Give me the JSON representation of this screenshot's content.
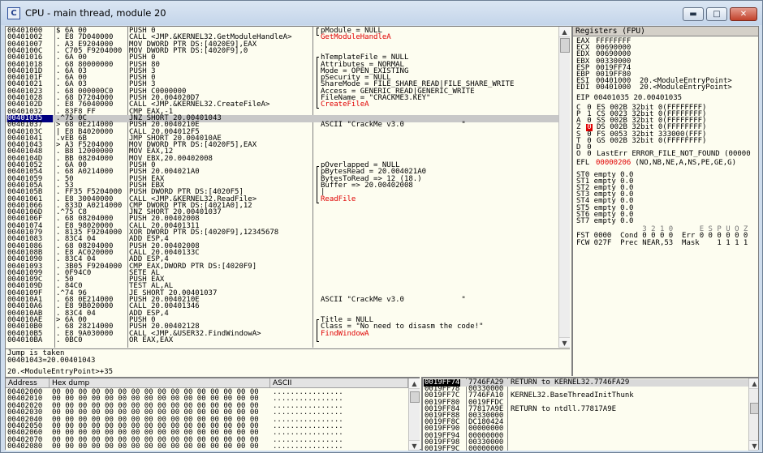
{
  "window": {
    "title": "CPU - main thread, module 20",
    "app_icon": "C",
    "controls": {
      "minimize": "▬",
      "maximize": "□",
      "close": "✕"
    }
  },
  "disasm": [
    {
      "a": "00401000",
      "h": "$ 6A 00",
      "i": "PUSH 0",
      "c": "pModule = NULL",
      "cc": ""
    },
    {
      "a": "00401002",
      "h": ". E8 7D040000",
      "i": "CALL <JMP.&KERNEL32.GetModuleHandleA>",
      "c": "GetModuleHandleA",
      "cc": "red"
    },
    {
      "a": "00401007",
      "h": ". A3 E9204000",
      "i": "MOV DWORD PTR DS:[4020E9],EAX",
      "c": "",
      "cc": ""
    },
    {
      "a": "0040100C",
      "h": ". C705 F9204000",
      "i": "MOV DWORD PTR DS:[4020F9],0",
      "c": "",
      "cc": ""
    },
    {
      "a": "00401016",
      "h": ". 6A 00",
      "i": "PUSH 0",
      "c": "hTemplateFile = NULL",
      "cc": ""
    },
    {
      "a": "00401018",
      "h": ". 68 80000000",
      "i": "PUSH 80",
      "c": "Attributes = NORMAL",
      "cc": ""
    },
    {
      "a": "0040101D",
      "h": ". 6A 03",
      "i": "PUSH 3",
      "c": "Mode = OPEN_EXISTING",
      "cc": ""
    },
    {
      "a": "0040101F",
      "h": ". 6A 00",
      "i": "PUSH 0",
      "c": "pSecurity = NULL",
      "cc": ""
    },
    {
      "a": "00401021",
      "h": ". 6A 03",
      "i": "PUSH 3",
      "c": "ShareMode = FILE_SHARE_READ|FILE_SHARE_WRITE",
      "cc": ""
    },
    {
      "a": "00401023",
      "h": ". 68 000000C0",
      "i": "PUSH C0000000",
      "c": "Access = GENERIC_READ|GENERIC_WRITE",
      "cc": ""
    },
    {
      "a": "00401028",
      "h": ". 68 D7204000",
      "i": "PUSH 20.004020D7",
      "c": "FileName = \"CRACKME3.KEY\"",
      "cc": ""
    },
    {
      "a": "0040102D",
      "h": ". E8 76040000",
      "i": "CALL <JMP.&KERNEL32.CreateFileA>",
      "c": "CreateFileA",
      "cc": "red"
    },
    {
      "a": "00401032",
      "h": ". 83F8 FF",
      "i": "CMP EAX,-1",
      "c": "",
      "cc": ""
    },
    {
      "a": "00401035",
      "h": ".^75 0C",
      "i": "JNZ SHORT 20.00401043",
      "c": "",
      "cc": "",
      "sel": true
    },
    {
      "a": "00401037",
      "h": "> 68 0E214000",
      "i": "PUSH 20.0040210E",
      "c": "ASCII \"CrackMe v3.0             \"",
      "cc": ""
    },
    {
      "a": "0040103C",
      "h": "| E8 B4020000",
      "i": "CALL 20.004012F5",
      "c": "",
      "cc": ""
    },
    {
      "a": "00401041",
      "h": ".vEB 6B",
      "i": "JMP SHORT 20.004010AE",
      "c": "",
      "cc": ""
    },
    {
      "a": "00401043",
      "h": "> A3 F5204000",
      "i": "MOV DWORD PTR DS:[4020F5],EAX",
      "c": "",
      "cc": ""
    },
    {
      "a": "00401048",
      "h": ". B8 12000000",
      "i": "MOV EAX,12",
      "c": "",
      "cc": ""
    },
    {
      "a": "0040104D",
      "h": ". BB 08204000",
      "i": "MOV EBX,20.00402008",
      "c": "",
      "cc": ""
    },
    {
      "a": "00401052",
      "h": ". 6A 00",
      "i": "PUSH 0",
      "c": "pOverlapped = NULL",
      "cc": ""
    },
    {
      "a": "00401054",
      "h": ". 68 A0214000",
      "i": "PUSH 20.004021A0",
      "c": "pBytesRead = 20.004021A0",
      "cc": ""
    },
    {
      "a": "00401059",
      "h": ". 50",
      "i": "PUSH EAX",
      "c": "BytesToRead => 12 (18.)",
      "cc": ""
    },
    {
      "a": "0040105A",
      "h": ". 53",
      "i": "PUSH EBX",
      "c": "Buffer => 20.00402008",
      "cc": ""
    },
    {
      "a": "0040105B",
      "h": ". FF35 F5204000",
      "i": "PUSH DWORD PTR DS:[4020F5]",
      "c": "|",
      "cc": ""
    },
    {
      "a": "00401061",
      "h": ". E8 30040000",
      "i": "CALL <JMP.&KERNEL32.ReadFile>",
      "c": "ReadFile",
      "cc": "red"
    },
    {
      "a": "00401066",
      "h": ". 833D A0214000",
      "i": "CMP DWORD PTR DS:[4021A0],12",
      "c": "",
      "cc": ""
    },
    {
      "a": "0040106D",
      "h": ".^75 C8",
      "i": "JNZ SHORT 20.00401037",
      "c": "",
      "cc": ""
    },
    {
      "a": "0040106F",
      "h": ". 68 08204000",
      "i": "PUSH 20.00402008",
      "c": "",
      "cc": ""
    },
    {
      "a": "00401074",
      "h": ". E8 98020000",
      "i": "CALL 20.00401311",
      "c": "",
      "cc": ""
    },
    {
      "a": "00401079",
      "h": ". 8135 F9204000",
      "i": "XOR DWORD PTR DS:[4020F9],12345678",
      "c": "",
      "cc": ""
    },
    {
      "a": "00401083",
      "h": ". 83C4 04",
      "i": "ADD ESP,4",
      "c": "",
      "cc": ""
    },
    {
      "a": "00401086",
      "h": ". 68 08204000",
      "i": "PUSH 20.00402008",
      "c": "",
      "cc": ""
    },
    {
      "a": "0040108B",
      "h": ". E8 AC020000",
      "i": "CALL 20.0040133C",
      "c": "",
      "cc": ""
    },
    {
      "a": "00401090",
      "h": ". 83C4 04",
      "i": "ADD ESP,4",
      "c": "",
      "cc": ""
    },
    {
      "a": "00401093",
      "h": ". 3B05 F9204000",
      "i": "CMP EAX,DWORD PTR DS:[4020F9]",
      "c": "",
      "cc": ""
    },
    {
      "a": "00401099",
      "h": ". 0F94C0",
      "i": "SETE AL",
      "c": "",
      "cc": ""
    },
    {
      "a": "0040109C",
      "h": ". 50",
      "i": "PUSH EAX",
      "c": "",
      "cc": ""
    },
    {
      "a": "0040109D",
      "h": ". 84C0",
      "i": "TEST AL,AL",
      "c": "",
      "cc": ""
    },
    {
      "a": "0040109F",
      "h": ".^74 96",
      "i": "JE SHORT 20.00401037",
      "c": "",
      "cc": ""
    },
    {
      "a": "004010A1",
      "h": ". 68 0E214000",
      "i": "PUSH 20.0040210E",
      "c": "ASCII \"CrackMe v3.0             \"",
      "cc": ""
    },
    {
      "a": "004010A6",
      "h": ". E8 9B020000",
      "i": "CALL 20.00401346",
      "c": "",
      "cc": ""
    },
    {
      "a": "004010AB",
      "h": ". 83C4 04",
      "i": "ADD ESP,4",
      "c": "",
      "cc": ""
    },
    {
      "a": "004010AE",
      "h": "> 6A 00",
      "i": "PUSH 0",
      "c": "Title = NULL",
      "cc": ""
    },
    {
      "a": "004010B0",
      "h": ". 68 28214000",
      "i": "PUSH 20.00402128",
      "c": "Class = \"No need to disasm the code!\"",
      "cc": ""
    },
    {
      "a": "004010B5",
      "h": ". E8 9A030000",
      "i": "CALL <JMP.&USER32.FindWindowA>",
      "c": "FindWindowA",
      "cc": "red"
    },
    {
      "a": "004010BA",
      "h": ". 0BC0",
      "i": "OR EAX,EAX",
      "c": "",
      "cc": ""
    }
  ],
  "info": {
    "line1": "Jump is taken",
    "line2": "00401043=20.00401043",
    "line3": "20.<ModuleEntryPoint>+35"
  },
  "registers": {
    "title": "Registers (FPU)",
    "general": [
      {
        "n": "EAX",
        "v": "FFFFFFFF",
        "c": "",
        "r": false
      },
      {
        "n": "ECX",
        "v": "00690000",
        "c": "",
        "r": false
      },
      {
        "n": "EDX",
        "v": "00690000",
        "c": "",
        "r": false
      },
      {
        "n": "EBX",
        "v": "00330000",
        "c": "",
        "r": false
      },
      {
        "n": "ESP",
        "v": "0019FF74",
        "c": "",
        "r": false
      },
      {
        "n": "EBP",
        "v": "0019FF80",
        "c": "",
        "r": false
      },
      {
        "n": "ESI",
        "v": "00401000",
        "c": "20.<ModuleEntryPoint>",
        "r": false
      },
      {
        "n": "EDI",
        "v": "00401000",
        "c": "20.<ModuleEntryPoint>",
        "r": false
      }
    ],
    "eip": "EIP 00401035 20.00401035",
    "flags": [
      {
        "f": "C",
        "b": "0",
        "seg": "ES 002B 32bit 0(FFFFFFFF)",
        "hl": false
      },
      {
        "f": "P",
        "b": "1",
        "seg": "CS 0023 32bit 0(FFFFFFFF)",
        "hl": false
      },
      {
        "f": "A",
        "b": "0",
        "seg": "SS 002B 32bit 0(FFFFFFFF)",
        "hl": false
      },
      {
        "f": "Z",
        "b": "0",
        "seg": "DS 002B 32bit 0(FFFFFFFF)",
        "hl": true
      },
      {
        "f": "S",
        "b": "0",
        "seg": "FS 0053 32bit 333000(FFF)",
        "hl": false
      },
      {
        "f": "T",
        "b": "0",
        "seg": "GS 002B 32bit 0(FFFFFFFF)",
        "hl": false
      },
      {
        "f": "D",
        "b": "0",
        "seg": "",
        "hl": false
      },
      {
        "f": "O",
        "b": "0",
        "seg": "LastErr ERROR_FILE_NOT_FOUND (00000",
        "hl": false
      }
    ],
    "efl_label": "EFL",
    "efl_value": "00000206",
    "efl_desc": "(NO,NB,NE,A,NS,PE,GE,G)",
    "fpu": [
      "ST0 empty 0.0",
      "ST1 empty 0.0",
      "ST2 empty 0.0",
      "ST3 empty 0.0",
      "ST4 empty 0.0",
      "ST5 empty 0.0",
      "ST6 empty 0.0",
      "ST7 empty 0.0"
    ],
    "bits_header": "               3 2 1 0      E S P U O Z",
    "fst": "FST 0000  Cond 0 0 0 0  Err 0 0 0 0 0 0",
    "fcw": "FCW 027F  Prec NEAR,53  Mask    1 1 1 1"
  },
  "dump": {
    "headers": {
      "address": "Address",
      "hex": "Hex dump",
      "ascii": "ASCII"
    },
    "rows": [
      {
        "a": "00402000",
        "h": "00 00 00 00 00 00 00 00 00 00 00 00 00 00 00 00",
        "t": "................"
      },
      {
        "a": "00402010",
        "h": "00 00 00 00 00 00 00 00 00 00 00 00 00 00 00 00",
        "t": "................"
      },
      {
        "a": "00402020",
        "h": "00 00 00 00 00 00 00 00 00 00 00 00 00 00 00 00",
        "t": "................"
      },
      {
        "a": "00402030",
        "h": "00 00 00 00 00 00 00 00 00 00 00 00 00 00 00 00",
        "t": "................"
      },
      {
        "a": "00402040",
        "h": "00 00 00 00 00 00 00 00 00 00 00 00 00 00 00 00",
        "t": "................"
      },
      {
        "a": "00402050",
        "h": "00 00 00 00 00 00 00 00 00 00 00 00 00 00 00 00",
        "t": "................"
      },
      {
        "a": "00402060",
        "h": "00 00 00 00 00 00 00 00 00 00 00 00 00 00 00 00",
        "t": "................"
      },
      {
        "a": "00402070",
        "h": "00 00 00 00 00 00 00 00 00 00 00 00 00 00 00 00",
        "t": "................"
      },
      {
        "a": "00402080",
        "h": "00 00 00 00 00 00 00 00 00 00 00 00 00 00 00 00",
        "t": "................"
      }
    ]
  },
  "stack": [
    {
      "a": "0019FF74",
      "v": "7746FA29",
      "c": "RETURN to KERNEL32.7746FA29",
      "sel": true
    },
    {
      "a": "0019FF78",
      "v": "00330000",
      "c": "",
      "sel": false
    },
    {
      "a": "0019FF7C",
      "v": "7746FA10",
      "c": "KERNEL32.BaseThreadInitThunk",
      "sel": false
    },
    {
      "a": "0019FF80",
      "v": "0019FFDC",
      "c": "",
      "sel": false
    },
    {
      "a": "0019FF84",
      "v": "77817A9E",
      "c": "RETURN to ntdll.77817A9E",
      "sel": false
    },
    {
      "a": "0019FF88",
      "v": "00330000",
      "c": "",
      "sel": false
    },
    {
      "a": "0019FF8C",
      "v": "DC180424",
      "c": "",
      "sel": false
    },
    {
      "a": "0019FF90",
      "v": "00000000",
      "c": "",
      "sel": false
    },
    {
      "a": "0019FF94",
      "v": "00000000",
      "c": "",
      "sel": false
    },
    {
      "a": "0019FF98",
      "v": "00330000",
      "c": "",
      "sel": false
    },
    {
      "a": "0019FF9C",
      "v": "00000000",
      "c": "",
      "sel": false
    }
  ],
  "scroll": {
    "up": "▲",
    "down": "▼"
  }
}
